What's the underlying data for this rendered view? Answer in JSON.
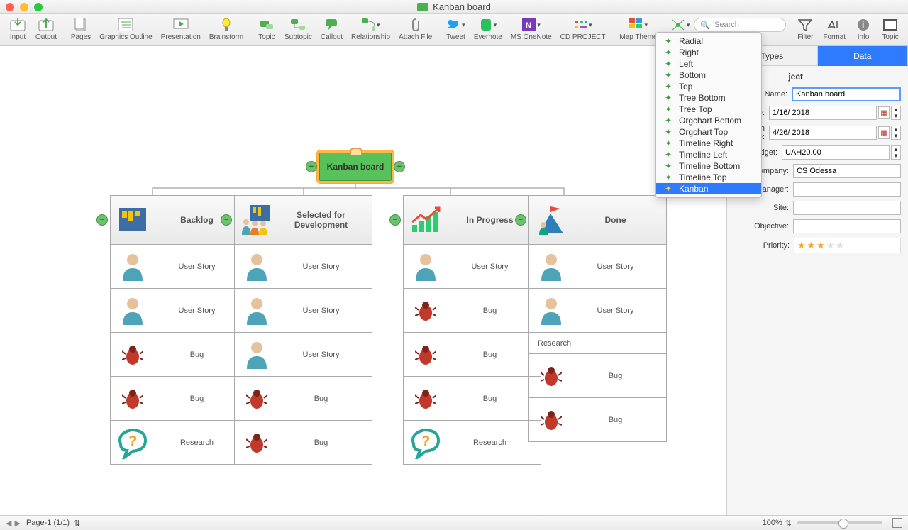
{
  "window": {
    "title": "Kanban board"
  },
  "titlebadge": "app-badge",
  "search": {
    "placeholder": "Search"
  },
  "toolbar": [
    {
      "id": "input",
      "label": "Input"
    },
    {
      "id": "output",
      "label": "Output"
    },
    {
      "id": "pages",
      "label": "Pages"
    },
    {
      "id": "graphics-outline",
      "label": "Graphics Outline"
    },
    {
      "id": "presentation",
      "label": "Presentation"
    },
    {
      "id": "brainstorm",
      "label": "Brainstorm"
    },
    {
      "id": "topic",
      "label": "Topic"
    },
    {
      "id": "subtopic",
      "label": "Subtopic"
    },
    {
      "id": "callout",
      "label": "Callout"
    },
    {
      "id": "relationship",
      "label": "Relationship"
    },
    {
      "id": "attach-file",
      "label": "Attach File"
    },
    {
      "id": "tweet",
      "label": "Tweet"
    },
    {
      "id": "evernote",
      "label": "Evernote"
    },
    {
      "id": "ms-onenote",
      "label": "MS OneNote"
    },
    {
      "id": "cd-project",
      "label": "CD PROJECT"
    },
    {
      "id": "map-theme",
      "label": "Map Theme"
    }
  ],
  "toolbar_right": [
    {
      "id": "filter",
      "label": "Filter"
    },
    {
      "id": "format",
      "label": "Format"
    },
    {
      "id": "info",
      "label": "Info"
    },
    {
      "id": "topic-side",
      "label": "Topic"
    }
  ],
  "layout_menu": [
    "Radial",
    "Right",
    "Left",
    "Bottom",
    "Top",
    "Tree Bottom",
    "Tree Top",
    "Orgchart Bottom",
    "Orgchart Top",
    "Timeline Right",
    "Timeline Left",
    "Timeline Bottom",
    "Timeline Top",
    "Kanban"
  ],
  "layout_menu_selected": "Kanban",
  "root": {
    "title": "Kanban board"
  },
  "columns": [
    {
      "title": "Backlog",
      "icon": "kanban-board-icon",
      "cards": [
        {
          "label": "User Story",
          "icon": "person"
        },
        {
          "label": "User Story",
          "icon": "person"
        },
        {
          "label": "Bug",
          "icon": "bug"
        },
        {
          "label": "Bug",
          "icon": "bug"
        },
        {
          "label": "Research",
          "icon": "question"
        }
      ]
    },
    {
      "title": "Selected for Development",
      "icon": "team-board-icon",
      "cards": [
        {
          "label": "User Story",
          "icon": "person"
        },
        {
          "label": "User Story",
          "icon": "person"
        },
        {
          "label": "User Story",
          "icon": "person"
        },
        {
          "label": "Bug",
          "icon": "bug"
        },
        {
          "label": "Bug",
          "icon": "bug"
        }
      ]
    },
    {
      "title": "In Progress",
      "icon": "chart-up-icon",
      "cards": [
        {
          "label": "User Story",
          "icon": "person"
        },
        {
          "label": "Bug",
          "icon": "bug"
        },
        {
          "label": "Bug",
          "icon": "bug"
        },
        {
          "label": "Bug",
          "icon": "bug"
        },
        {
          "label": "Research",
          "icon": "question"
        }
      ]
    },
    {
      "title": "Done",
      "icon": "flag-mountain-icon",
      "cards": [
        {
          "label": "User Story",
          "icon": "person"
        },
        {
          "label": "User Story",
          "icon": "person"
        },
        {
          "label": "Research",
          "icon": "text",
          "small": true
        },
        {
          "label": "Bug",
          "icon": "bug"
        },
        {
          "label": "Bug",
          "icon": "bug"
        }
      ]
    }
  ],
  "inspector": {
    "tabs": [
      "Types",
      "Data"
    ],
    "active_tab": "Data",
    "section_title_visible": "ject",
    "fields": {
      "name_label": "Name:",
      "name_value": "Kanban board",
      "start_label": "art Date:",
      "start_value": "1/16/ 2018",
      "finish_label": "nish Date:",
      "finish_value": "4/26/ 2018",
      "budget_label": "Budget:",
      "budget_value": "UAH20.00",
      "company_label": "Company:",
      "company_value": "CS Odessa",
      "manager_label": "Manager:",
      "manager_value": "",
      "site_label": "Site:",
      "site_value": "",
      "objective_label": "Objective:",
      "objective_value": "",
      "priority_label": "Priority:",
      "priority_stars": 3
    }
  },
  "statusbar": {
    "page_label": "Page-1 (1/1)",
    "zoom_label": "100%"
  }
}
